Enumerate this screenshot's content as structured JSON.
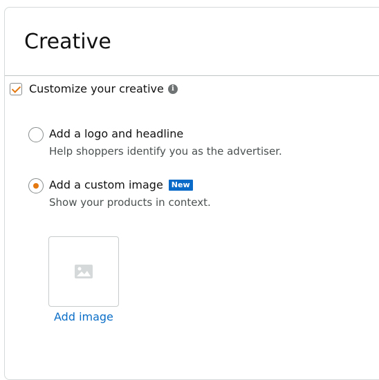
{
  "section": {
    "title": "Creative"
  },
  "customize": {
    "label": "Customize your creative",
    "checked": true,
    "info_icon": "info-icon"
  },
  "options": [
    {
      "label": "Add a logo and headline",
      "description": "Help shoppers identify you as the advertiser.",
      "selected": false
    },
    {
      "label": "Add a custom image",
      "badge": "New",
      "description": "Show your products in context.",
      "selected": true
    }
  ],
  "image_upload": {
    "placeholder_icon": "image-placeholder-icon",
    "link_label": "Add image"
  },
  "colors": {
    "accent_orange": "#e47911",
    "link_blue": "#0b6ec7",
    "badge_blue": "#0a6ac7"
  }
}
